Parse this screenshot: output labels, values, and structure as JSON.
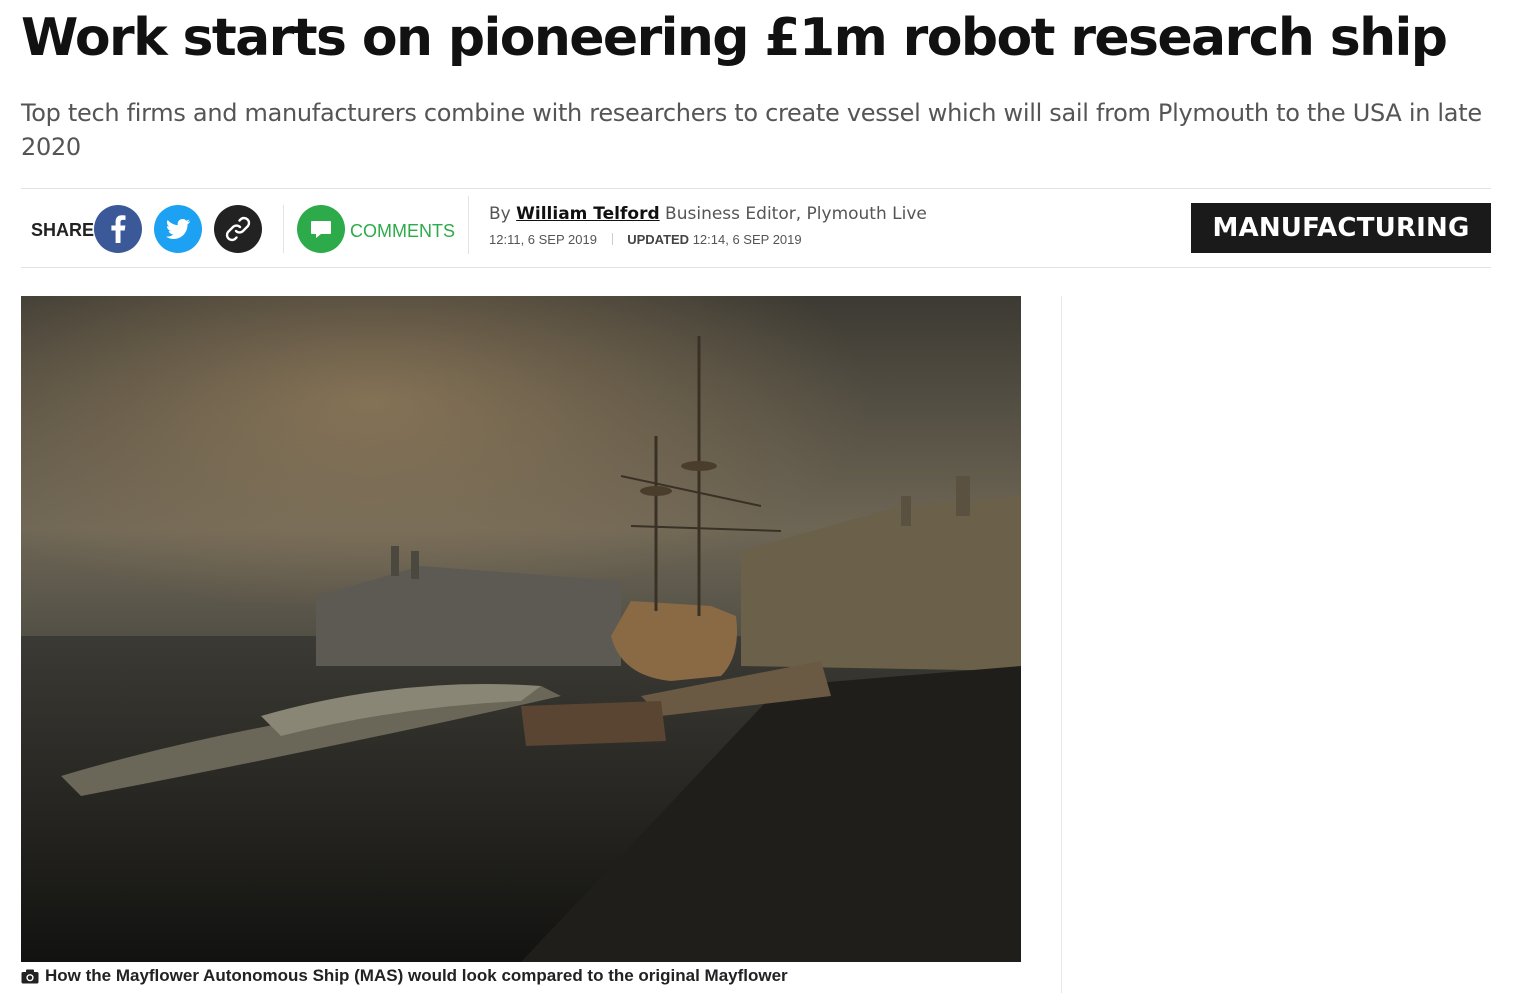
{
  "article": {
    "headline": "Work starts on pioneering £1m robot research ship",
    "standfirst": "Top tech firms and manufacturers combine with researchers to create vessel which will sail from Plymouth to the USA in late 2020"
  },
  "share": {
    "label": "SHARE",
    "icons": [
      "facebook-icon",
      "twitter-icon",
      "link-icon"
    ],
    "comments_label": "COMMENTS",
    "colors": {
      "facebook": "#3b5998",
      "twitter": "#1da1f2",
      "link": "#222222",
      "comments": "#2dab4a"
    }
  },
  "byline": {
    "by": "By",
    "author": "William Telford",
    "role": "Business Editor, Plymouth Live",
    "published": "12:11, 6 SEP 2019",
    "updated_label": "UPDATED",
    "updated": "12:14, 6 SEP 2019"
  },
  "category": {
    "label": "MANUFACTURING"
  },
  "image": {
    "caption": "How the Mayflower Autonomous Ship (MAS) would look compared to the original Mayflower"
  }
}
